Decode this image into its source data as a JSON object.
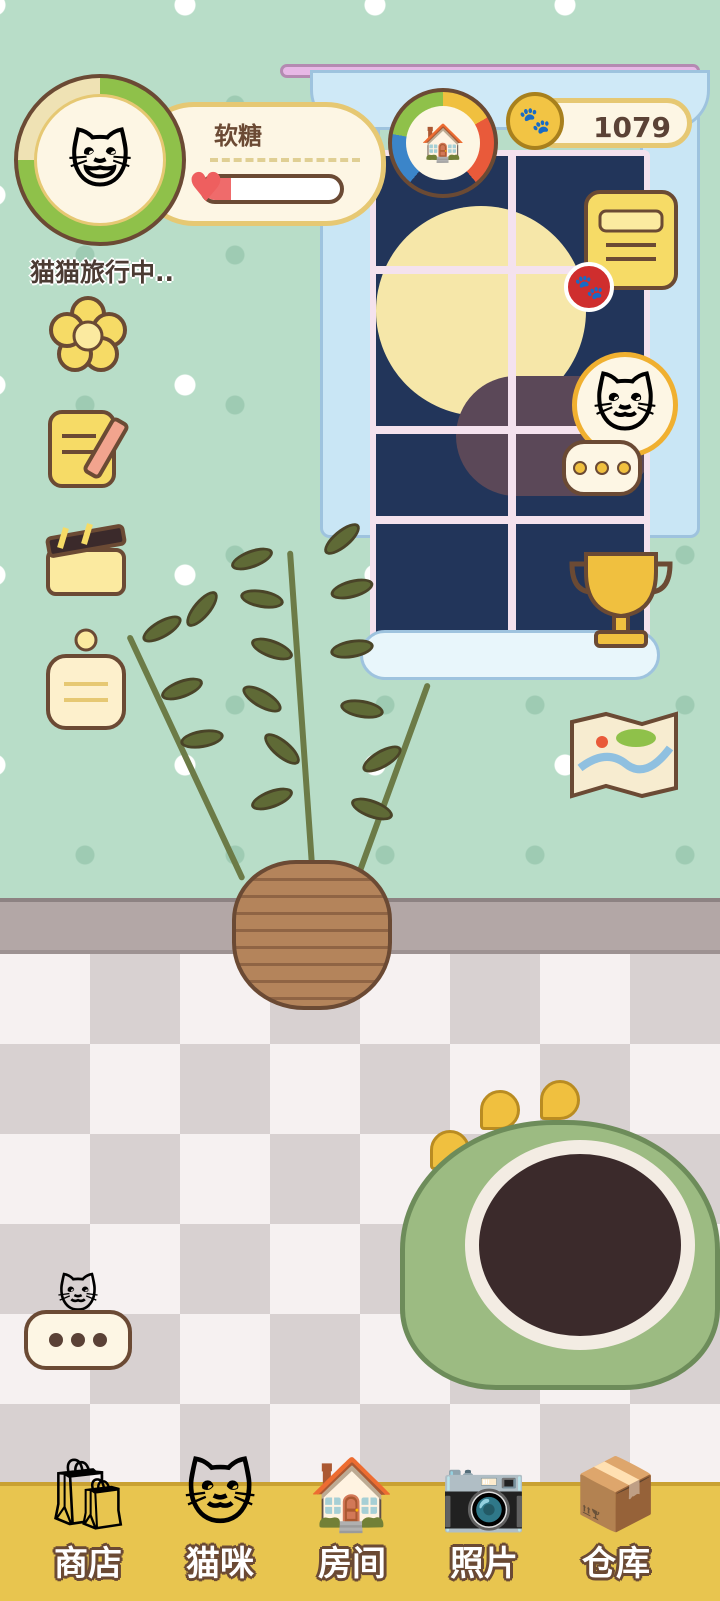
{
  "player": {
    "name": "软糖",
    "status": "猫猫旅行中..",
    "avatar_icon": "cat-face-icon",
    "affection_fraction": 0.2
  },
  "currency": {
    "coins": "1079",
    "coin_icon": "paw-coin-icon"
  },
  "left_menu": [
    {
      "id": "flower",
      "icon": "flower-icon",
      "glyph": "✿"
    },
    {
      "id": "notes",
      "icon": "notepad-pencil-icon",
      "glyph": "📝"
    },
    {
      "id": "clapper",
      "icon": "clapperboard-icon",
      "glyph": "🎬"
    },
    {
      "id": "board",
      "icon": "hanging-sign-icon",
      "glyph": "▤"
    }
  ],
  "right_menu": [
    {
      "id": "tasks",
      "icon": "task-list-icon"
    },
    {
      "id": "visitor-cat",
      "icon": "calico-cat-icon"
    },
    {
      "id": "trophy",
      "icon": "trophy-icon",
      "glyph": "🏆"
    },
    {
      "id": "map",
      "icon": "map-icon",
      "glyph": "🗺"
    }
  ],
  "nav": {
    "items": [
      {
        "label": "商店",
        "icon": "shopping-bag-icon",
        "glyph": "🛍"
      },
      {
        "label": "猫咪",
        "icon": "cat-icon",
        "glyph": "🐱"
      },
      {
        "label": "房间",
        "icon": "house-icon",
        "glyph": "🏠"
      },
      {
        "label": "照片",
        "icon": "camera-icon",
        "glyph": "📷"
      },
      {
        "label": "仓库",
        "icon": "box-icon",
        "glyph": "📦"
      }
    ]
  },
  "colors": {
    "wall": "#b8ddc8",
    "accent_gold": "#e8c54f",
    "outline_brown": "#6b4a34",
    "heart_red": "#ef6b6b"
  }
}
